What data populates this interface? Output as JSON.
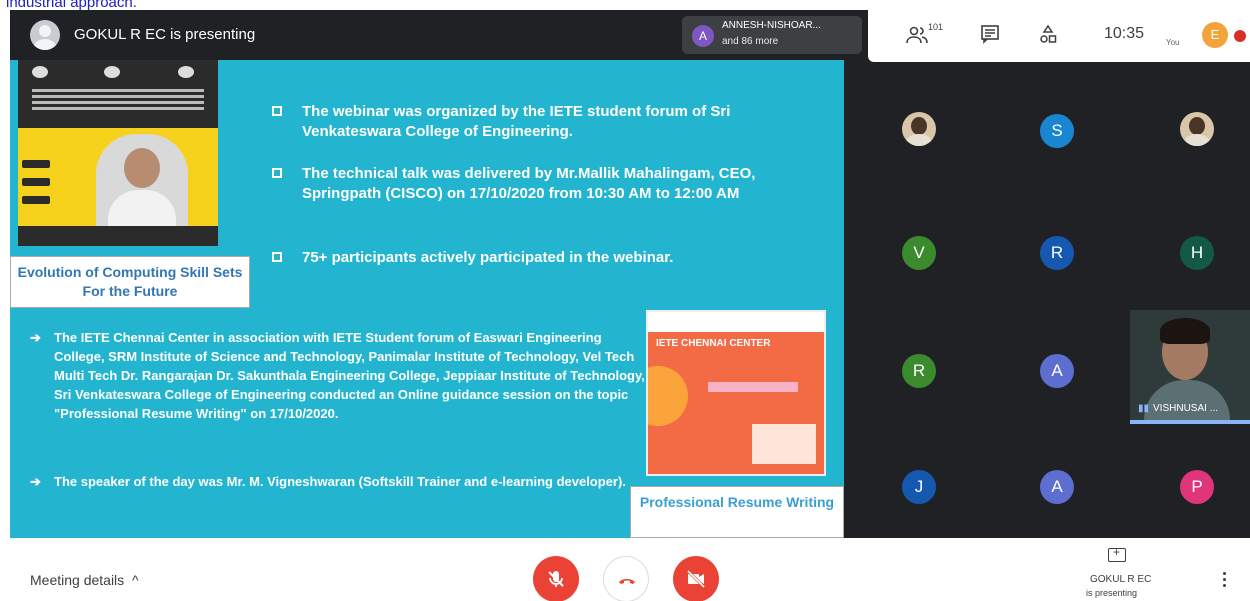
{
  "doc_snippet": "industrial approach.",
  "presenter": {
    "label": "GOKUL R EC is presenting"
  },
  "others": {
    "avatar": "A",
    "name": "ANNESH-NISHOAR...",
    "more": "and 86 more"
  },
  "controls": {
    "people_count": "101",
    "time": "10:35",
    "you_label": "You",
    "self_initial": "E"
  },
  "slide": {
    "caption_left": "Evolution of Computing Skill Sets For the Future",
    "bullets": [
      "The webinar was organized by the IETE student forum of Sri Venkateswara College of Engineering.",
      "The technical talk was delivered by Mr.Mallik Mahalingam, CEO, Springpath (CISCO) on 17/10/2020 from 10:30 AM to 12:00 AM",
      "75+ participants actively participated in the webinar."
    ],
    "arrows": [
      "The IETE Chennai Center in association with IETE Student forum of Easwari Engineering College, SRM Institute of Science and Technology, Panimalar Institute of Technology, Vel Tech Multi Tech Dr. Rangarajan Dr. Sakunthala Engineering College, Jeppiaar Institute of Technology, Sri Venkateswara College of Engineering conducted an Online guidance session on the topic \"Professional Resume Writing\" on 17/10/2020.",
      "The speaker of the day was Mr. M. Vigneshwaran (Softskill Trainer and e-learning developer)."
    ],
    "poster2_heading": "IETE CHENNAI CENTER",
    "caption_right": "Professional Resume Writing"
  },
  "participants": [
    {
      "initial": "",
      "color": "#d9c6a8",
      "photo": true
    },
    {
      "initial": "S",
      "color": "#1a86d0"
    },
    {
      "initial": "",
      "color": "#d9c6a8",
      "photo": true
    },
    {
      "initial": "V",
      "color": "#3c8a2e"
    },
    {
      "initial": "R",
      "color": "#1558b0"
    },
    {
      "initial": "H",
      "color": "#135a45"
    },
    {
      "initial": "R",
      "color": "#3c8a2e"
    },
    {
      "initial": "A",
      "color": "#5e6ed0"
    },
    {
      "initial": "J",
      "color": "#1558b0"
    },
    {
      "initial": "A",
      "color": "#5e6ed0"
    },
    {
      "initial": "P",
      "color": "#e0357a"
    }
  ],
  "camera_tile": {
    "name": "VISHNUSAI ..."
  },
  "bottom": {
    "meeting_details": "Meeting details",
    "present_name": "GOKUL R EC",
    "present_sub": "is presenting"
  }
}
